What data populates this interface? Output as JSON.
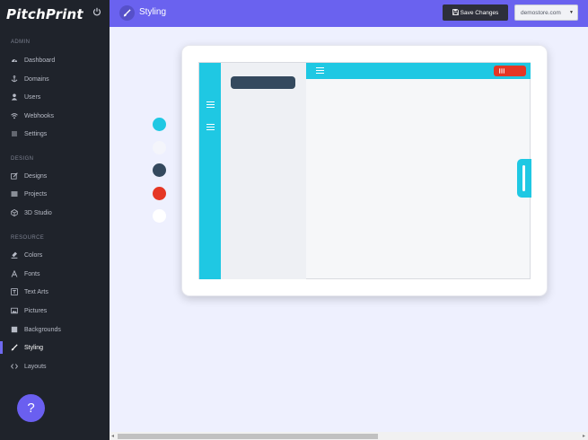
{
  "app": {
    "logo": "PitchPrint"
  },
  "sidebar": {
    "sections": {
      "admin": "ADMIN",
      "design": "DESIGN",
      "resource": "RESOURCE"
    },
    "items": [
      {
        "label": "Dashboard",
        "icon": "dashboard-icon"
      },
      {
        "label": "Domains",
        "icon": "anchor-icon"
      },
      {
        "label": "Users",
        "icon": "user-icon"
      },
      {
        "label": "Webhooks",
        "icon": "wifi-icon"
      },
      {
        "label": "Settings",
        "icon": "settings-icon"
      },
      {
        "label": "Designs",
        "icon": "edit-icon"
      },
      {
        "label": "Projects",
        "icon": "list-icon"
      },
      {
        "label": "3D Studio",
        "icon": "cube-icon"
      },
      {
        "label": "Colors",
        "icon": "color-icon"
      },
      {
        "label": "Fonts",
        "icon": "font-icon"
      },
      {
        "label": "Text Arts",
        "icon": "text-art-icon"
      },
      {
        "label": "Pictures",
        "icon": "picture-icon"
      },
      {
        "label": "Backgrounds",
        "icon": "background-icon"
      },
      {
        "label": "Styling",
        "icon": "brush-icon",
        "active": true
      },
      {
        "label": "Layouts",
        "icon": "code-icon"
      }
    ],
    "help_label": "?"
  },
  "header": {
    "title": "Styling",
    "save_label": "Save Changes",
    "store_selected": "demostore.com"
  },
  "styling": {
    "palette": [
      "#1fc8e3",
      "#f4f5fb",
      "#34495e",
      "#e53624",
      "#ffffff"
    ]
  },
  "colors": {
    "accent": "#6a62ef",
    "sidebar_bg": "#1f232b",
    "cyan": "#1fc8e3",
    "navy": "#34495e",
    "red": "#e53624"
  }
}
